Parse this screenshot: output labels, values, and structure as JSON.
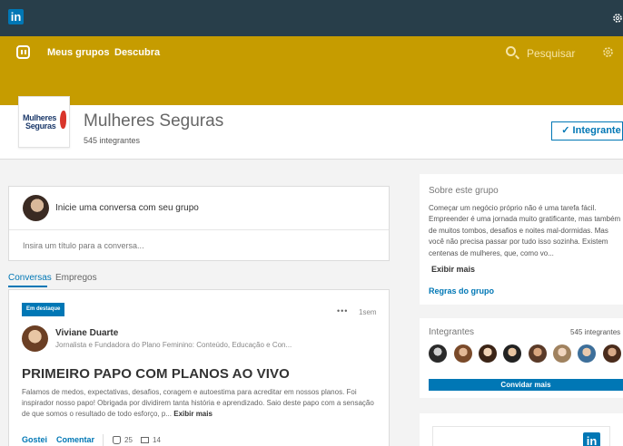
{
  "topbar": {
    "logo": "in"
  },
  "nav": {
    "groups": "Meus grupos",
    "discover": "Descubra",
    "search_placeholder": "Pesquisar"
  },
  "group": {
    "logo_line1": "Mulheres",
    "logo_line2": "Seguras",
    "name": "Mulheres Seguras",
    "members": "545 integrantes",
    "member_button": "✓ Integrante"
  },
  "composer": {
    "prompt": "Inicie uma conversa com seu grupo",
    "title_placeholder": "Insira um título para a conversa..."
  },
  "tabs": {
    "conversations": "Conversas",
    "jobs": "Empregos"
  },
  "post": {
    "badge": "Em destaque",
    "menu": "•••",
    "time": "1sem",
    "author": "Viviane Duarte",
    "author_headline": "Jornalista e Fundadora do Plano Feminino: Conteúdo, Educação e Con...",
    "title": "PRIMEIRO PAPO COM PLANOS AO VIVO",
    "body": "Falamos de medos, expectativas, desafios, coragem e autoestima para acreditar em nossos planos. Foi inspirador nosso papo! Obrigada por dividirem tanta história e aprendizado. Saio deste papo com a sensação de que somos o resultado de todo esforço, p...",
    "more": "Exibir mais",
    "like": "Gostei",
    "comment": "Comentar",
    "likes": "25",
    "comments": "14"
  },
  "about": {
    "title": "Sobre este grupo",
    "text": "Começar um negócio próprio não é uma tarefa fácil. Empreender é uma jornada muito gratificante, mas também de muitos tombos, desafios e noites mal-dormidas. Mas você não precisa passar por tudo isso sozinha. Existem centenas de mulheres, que, como vo...",
    "more": "Exibir mais",
    "rules": "Regras do grupo"
  },
  "members": {
    "title": "Integrantes",
    "count": "545 integrantes",
    "invite": "Convidar mais"
  },
  "ad": {
    "logo": "in"
  },
  "colors": {
    "brand_blue": "#0077b5",
    "gold": "#c69c00",
    "top_dark": "#283e4a"
  }
}
